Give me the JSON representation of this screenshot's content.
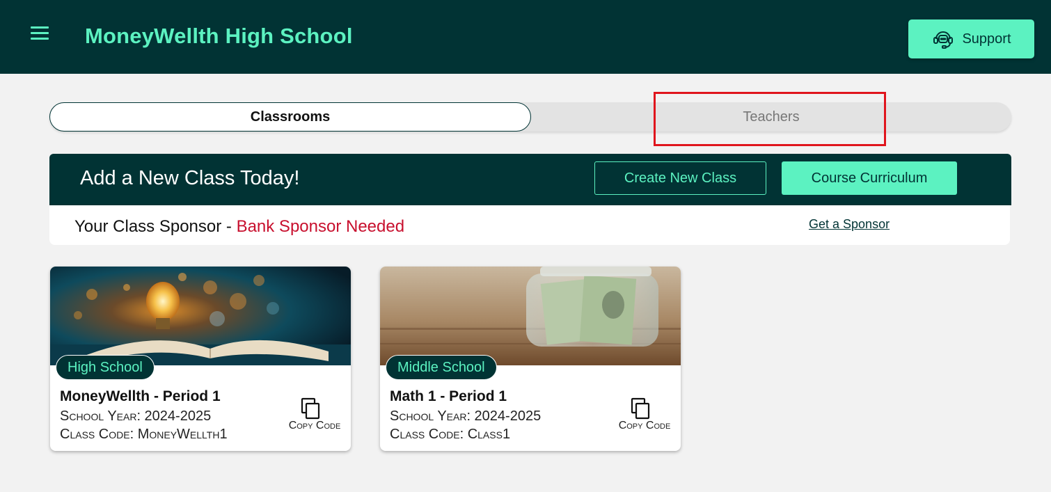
{
  "header": {
    "title": "MoneyWellth High School",
    "menu_icon": "hamburger-menu-icon",
    "support_label": "Support",
    "support_icon": "headset-chat-icon",
    "bg_color": "#013334",
    "accent_color": "#5cf2c1"
  },
  "tabs": [
    {
      "label": "Classrooms",
      "active": true
    },
    {
      "label": "Teachers",
      "active": false
    }
  ],
  "banner": {
    "title": "Add a New Class Today!",
    "create_label": "Create New Class",
    "curriculum_label": "Course Curriculum"
  },
  "sponsor": {
    "prefix": "Your Class Sponsor - ",
    "status": "Bank Sponsor Needed",
    "status_color": "#c8102e",
    "link_label": "Get a Sponsor"
  },
  "classes": [
    {
      "level": "High School",
      "title": "MoneyWellth - Period 1",
      "year": "School Year: 2024-2025",
      "code": "Class Code: MoneyWellth1",
      "copy_label": "Copy Code",
      "image": "lightbulb-book-coins-image"
    },
    {
      "level": "Middle School",
      "title": "Math 1 - Period 1",
      "year": "School Year: 2024-2025",
      "code": "Class Code: Class1",
      "copy_label": "Copy Code",
      "image": "money-jar-image"
    }
  ]
}
